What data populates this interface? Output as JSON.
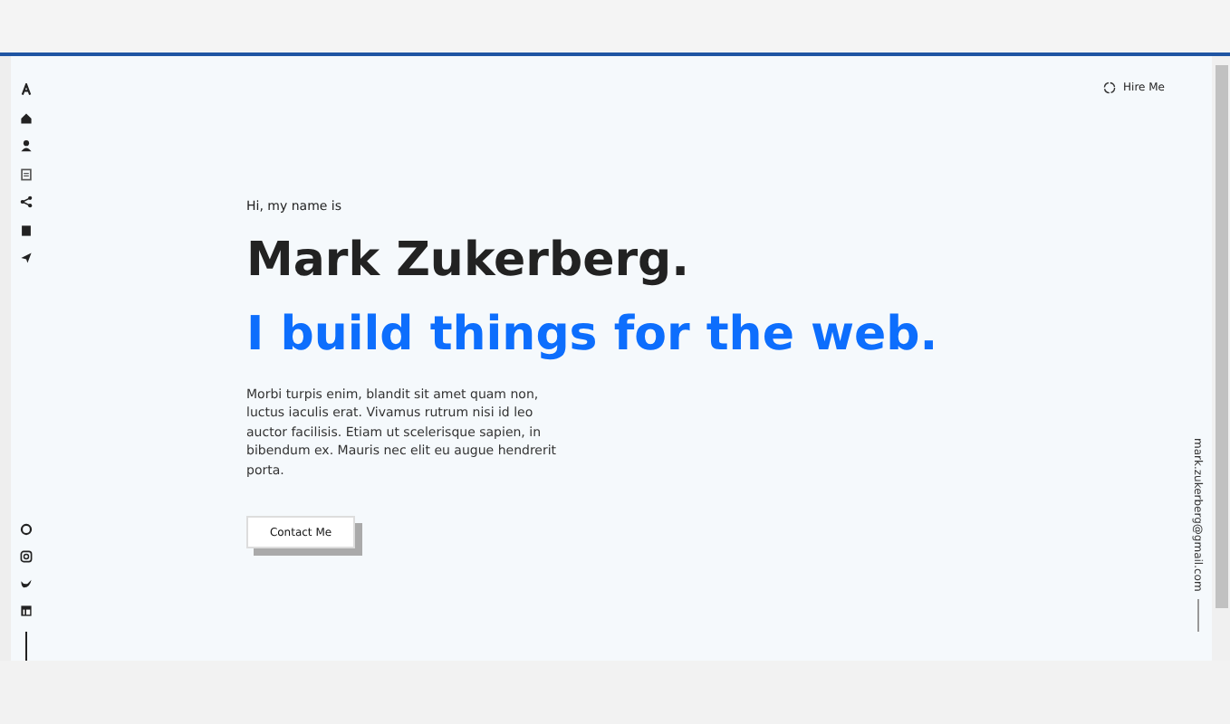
{
  "hire_button": {
    "label": "Hire Me"
  },
  "intro": "Hi, my name is",
  "name": "Mark Zukerberg.",
  "tagline": "I build things for the web.",
  "description": "Morbi turpis enim, blandit sit amet quam non, luctus iaculis erat. Vivamus rutrum nisi id leo auctor facilisis. Etiam ut scelerisque sapien, in bibendum ex. Mauris nec elit eu augue hendrerit porta.",
  "contact_button": {
    "label": "Contact Me"
  },
  "email": "mark.zukerberg@gmail.com"
}
